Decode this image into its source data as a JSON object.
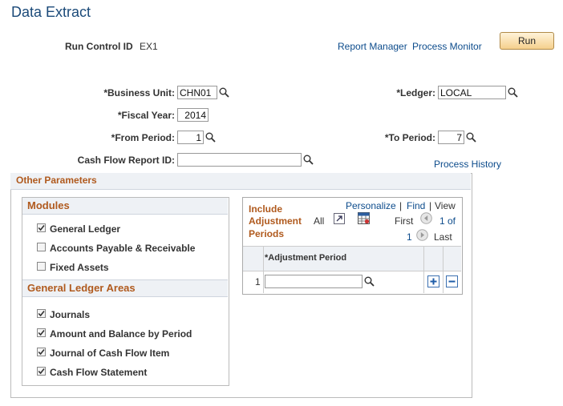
{
  "page": {
    "title": "Data Extract"
  },
  "run_control": {
    "label": "Run Control ID",
    "value": "EX1"
  },
  "links": {
    "report_manager": "Report Manager",
    "process_monitor": "Process Monitor",
    "process_history": "Process History"
  },
  "run_button": "Run",
  "fields": {
    "business_unit": {
      "label": "*Business Unit:",
      "value": "CHN01"
    },
    "ledger": {
      "label": "*Ledger:",
      "value": "LOCAL"
    },
    "fiscal_year": {
      "label": "*Fiscal Year:",
      "value": "2014"
    },
    "from_period": {
      "label": "*From Period:",
      "value": "1"
    },
    "to_period": {
      "label": "*To Period:",
      "value": "7"
    },
    "cash_flow_report_id": {
      "label": "Cash Flow Report ID:",
      "value": ""
    }
  },
  "other_parameters": {
    "title": "Other Parameters"
  },
  "modules": {
    "title": "Modules",
    "items": [
      {
        "label": "General Ledger",
        "checked": true
      },
      {
        "label": "Accounts Payable & Receivable",
        "checked": false
      },
      {
        "label": "Fixed Assets",
        "checked": false
      }
    ]
  },
  "gl_areas": {
    "title": "General Ledger Areas",
    "items": [
      {
        "label": "Journals",
        "checked": true
      },
      {
        "label": "Amount and Balance by Period",
        "checked": true
      },
      {
        "label": "Journal of Cash Flow Item",
        "checked": true
      },
      {
        "label": "Cash Flow Statement",
        "checked": true
      }
    ]
  },
  "adj_grid": {
    "title_line1": "Include",
    "title_line2": "Adjustment",
    "title_line3": "Periods",
    "personalize": "Personalize",
    "sep1": "|",
    "find": "Find",
    "sep2": "|",
    "view": "View",
    "view_all": "All",
    "first": "First",
    "range_start": "1",
    "range_of": "1 of",
    "range_total": "1",
    "last": "Last",
    "column": "*Adjustment Period",
    "row_number": "1",
    "row_value": ""
  }
}
